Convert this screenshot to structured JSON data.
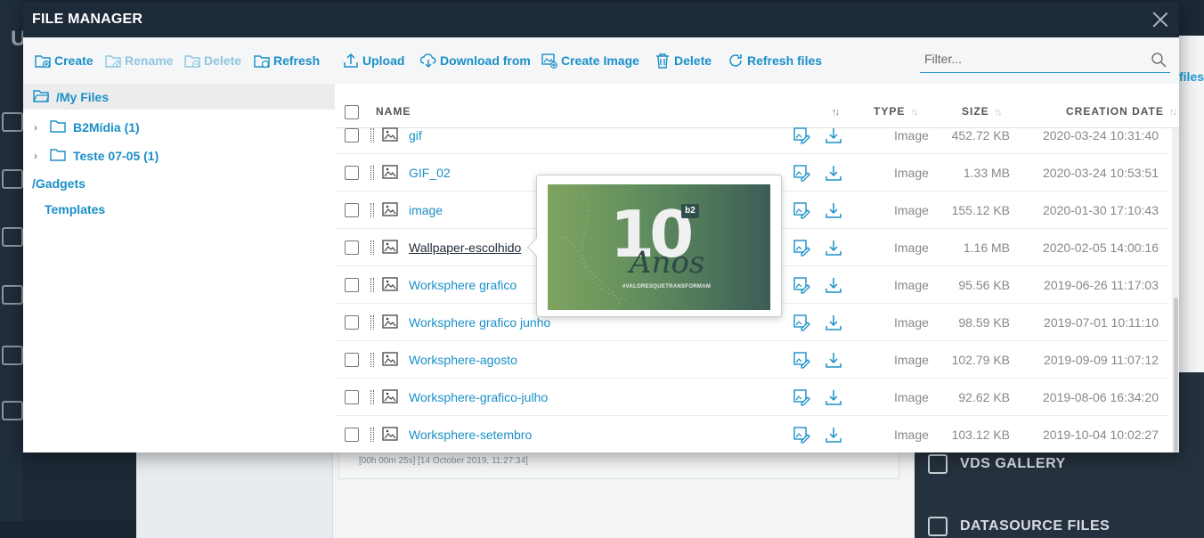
{
  "modal": {
    "title": "FILE MANAGER"
  },
  "toolbar": {
    "create": "Create",
    "rename": "Rename",
    "delete": "Delete",
    "refresh": "Refresh",
    "upload": "Upload",
    "download_from": "Download from",
    "create_image": "Create Image",
    "delete_files": "Delete",
    "refresh_files": "Refresh files",
    "filter_placeholder": "Filter..."
  },
  "tree": {
    "root": "/My Files",
    "children": [
      "B2Mídia (1)",
      "Teste 07-05 (1)"
    ],
    "gadgets": "/Gadgets",
    "templates": "Templates"
  },
  "grid": {
    "columns": {
      "name": "NAME",
      "type": "TYPE",
      "size": "SIZE",
      "date": "CREATION DATE"
    },
    "rows": [
      {
        "name": "gif",
        "type": "Image",
        "size": "452.72 KB",
        "date": "2020-03-24 10:31:40"
      },
      {
        "name": "GIF_02",
        "type": "Image",
        "size": "1.33 MB",
        "date": "2020-03-24 10:53:51"
      },
      {
        "name": "image",
        "type": "Image",
        "size": "155.12 KB",
        "date": "2020-01-30 17:10:43"
      },
      {
        "name": "Wallpaper-escolhido",
        "type": "Image",
        "size": "1.16 MB",
        "date": "2020-02-05 14:00:16"
      },
      {
        "name": "Worksphere grafico",
        "type": "Image",
        "size": "95.56 KB",
        "date": "2019-06-26 11:17:03"
      },
      {
        "name": "Worksphere grafico junho",
        "type": "Image",
        "size": "98.59 KB",
        "date": "2019-07-01 10:11:10"
      },
      {
        "name": "Worksphere-agosto",
        "type": "Image",
        "size": "102.79 KB",
        "date": "2019-09-09 11:07:12"
      },
      {
        "name": "Worksphere-grafico-julho",
        "type": "Image",
        "size": "92.62 KB",
        "date": "2019-08-06 16:34:20"
      },
      {
        "name": "Worksphere-setembro",
        "type": "Image",
        "size": "103.12 KB",
        "date": "2019-10-04 10:02:27"
      }
    ]
  },
  "preview": {
    "big_number": "10",
    "word": "Anos",
    "badge": "b2",
    "hashtag": "#VALORESQUETRANSFORMAM"
  },
  "background": {
    "log_text": "[00h 00m 25s] [14 October 2019, 11:27:34]",
    "right_link": "files",
    "vds_gallery": "VDS GALLERY",
    "datasource_files": "DATASOURCE FILES",
    "logo_letter": "U"
  },
  "colors": {
    "accent": "#1a8fc8",
    "header": "#1d2a38"
  }
}
